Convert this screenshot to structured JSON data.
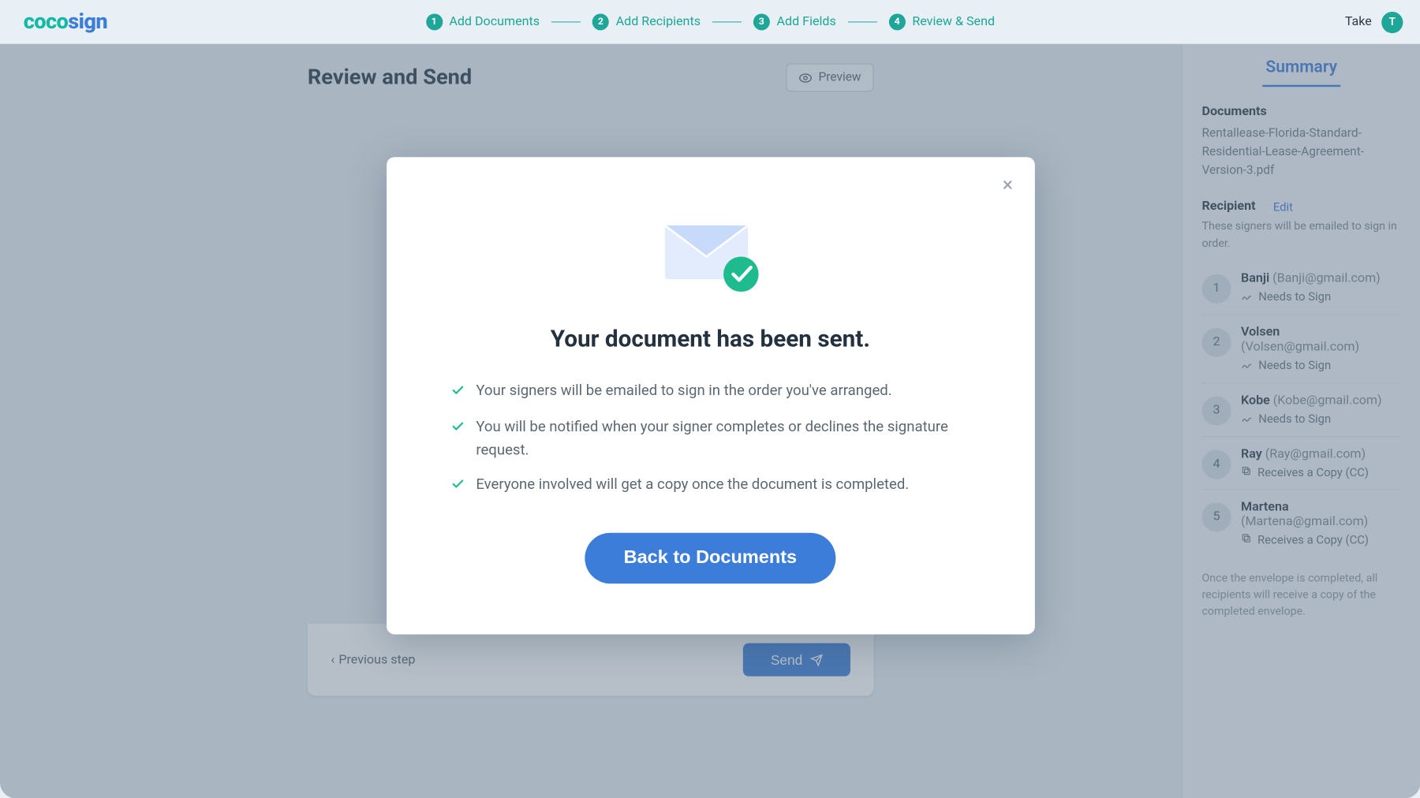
{
  "brand": {
    "part1": "coco",
    "part2": "sign"
  },
  "user": {
    "name": "Take",
    "initial": "T"
  },
  "stepper": [
    {
      "n": "1",
      "label": "Add Documents"
    },
    {
      "n": "2",
      "label": "Add Recipients"
    },
    {
      "n": "3",
      "label": "Add Fields"
    },
    {
      "n": "4",
      "label": "Review & Send"
    }
  ],
  "page": {
    "title": "Review and Send",
    "preview_btn": "Preview",
    "prev_step": "Previous step",
    "send_btn": "Send"
  },
  "sidepanel": {
    "tab": "Summary",
    "documents_label": "Documents",
    "document_name": "Rentallease-Florida-Standard-Residential-Lease-Agreement-Version-3.pdf",
    "recipient_label": "Recipient",
    "edit": "Edit",
    "note": "These signers will be emailed to sign in order.",
    "endnote": "Once the envelope is completed, all recipients will receive a copy of the completed envelope."
  },
  "recipients": [
    {
      "idx": "1",
      "name": "Banji",
      "email": "(Banji@gmail.com)",
      "role": "Needs to Sign",
      "icon": "sign"
    },
    {
      "idx": "2",
      "name": "Volsen",
      "email": "(Volsen@gmail.com)",
      "role": "Needs to Sign",
      "icon": "sign"
    },
    {
      "idx": "3",
      "name": "Kobe",
      "email": "(Kobe@gmail.com)",
      "role": "Needs to Sign",
      "icon": "sign"
    },
    {
      "idx": "4",
      "name": "Ray",
      "email": "(Ray@gmail.com)",
      "role": "Receives a Copy (CC)",
      "icon": "copy"
    },
    {
      "idx": "5",
      "name": "Martena",
      "email": "(Martena@gmail.com)",
      "role": "Receives a Copy (CC)",
      "icon": "copy"
    }
  ],
  "modal": {
    "title": "Your document has been sent.",
    "points": [
      "Your signers will be emailed to sign in the order you've arranged.",
      "You will be notified when your signer completes or declines the signature request.",
      "Everyone involved will get a copy once the document is completed."
    ],
    "cta": "Back to Documents"
  }
}
